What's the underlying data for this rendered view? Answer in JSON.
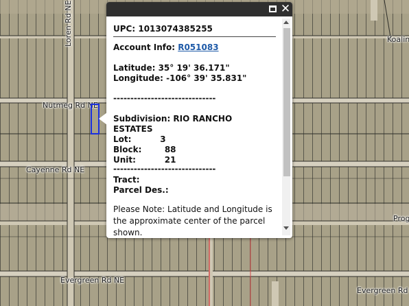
{
  "map": {
    "roads": {
      "loren": "Loren Rd NE",
      "nutmeg": "Nutmeg Rd NE",
      "cayenne": "Cayenne Rd NE",
      "evergreen_left": "Evergreen Rd NE",
      "evergreen_right": "Evergreen Rd NE",
      "koala": "Koalin",
      "prog": "Prog"
    }
  },
  "popup": {
    "upc_label": "UPC:",
    "upc_value": "1013074385255",
    "account_label": "Account Info:",
    "account_value": "R051083",
    "latitude_line": "Latitude: 35° 19' 36.171\"",
    "longitude_line": "Longitude: -106° 39' 35.831\"",
    "separator": "------------------------------",
    "subdivision_line1": "Subdivision: RIO RANCHO",
    "subdivision_line2": "ESTATES",
    "lot_line": "Lot:          3",
    "block_line": "Block:        88",
    "unit_line": "Unit:          21",
    "separator2": "------------------------------",
    "tract_line": "Tract:",
    "parcel_line": "Parcel Des.:",
    "note": "Please Note: Latitude and Longitude is the approximate center of the parcel shown."
  }
}
